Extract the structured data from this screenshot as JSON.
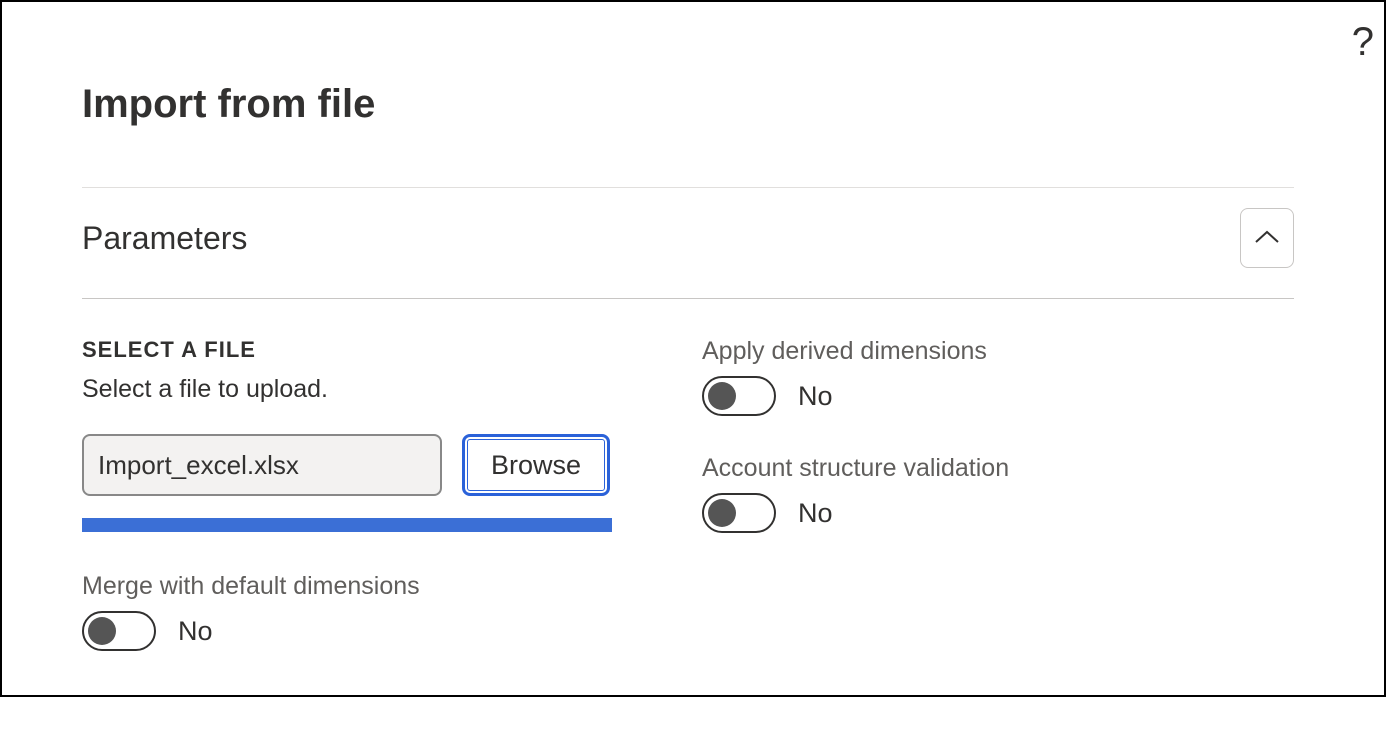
{
  "header": {
    "title": "Import from file"
  },
  "section": {
    "title": "Parameters",
    "select_file": {
      "heading": "SELECT A FILE",
      "help_text": "Select a file to upload.",
      "filename": "Import_excel.xlsx",
      "browse_label": "Browse"
    },
    "toggles": {
      "merge_default": {
        "label": "Merge with default dimensions",
        "value": "No"
      },
      "apply_derived": {
        "label": "Apply derived dimensions",
        "value": "No"
      },
      "account_validation": {
        "label": "Account structure validation",
        "value": "No"
      }
    }
  }
}
